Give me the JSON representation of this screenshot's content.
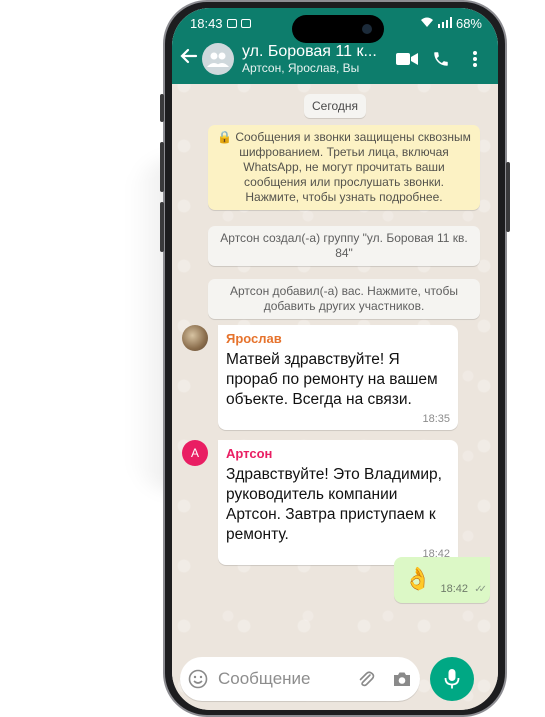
{
  "status_bar": {
    "time": "18:43",
    "battery": "68%"
  },
  "header": {
    "title": "ул. Боровая 11 к...",
    "subtitle": "Артсон, Ярослав, Вы",
    "icons": [
      "back-arrow-icon",
      "group-avatar-icon",
      "video-call-icon",
      "phone-call-icon",
      "more-options-icon"
    ]
  },
  "chat": {
    "date_chip": "Сегодня",
    "encryption_notice": "🔒 Сообщения и звонки защищены сквозным шифрованием. Третьи лица, включая WhatsApp, не могут прочитать ваши сообщения или прослушать звонки. Нажмите, чтобы узнать подробнее.",
    "system_created": "Артсон создал(-а) группу \"ул. Боровая 11 кв. 84\"",
    "system_added": "Артсон добавил(-а) вас. Нажмите, чтобы добавить других участников.",
    "messages": [
      {
        "sender": "Ярослав",
        "sender_color": "#e6732d",
        "text": "Матвей здравствуйте! Я прораб по ремонту на вашем объекте. Всегда на связи.",
        "time": "18:35"
      },
      {
        "sender": "Артсон",
        "sender_color": "#e91e63",
        "avatar_letter": "A",
        "text": "Здравствуйте! Это Владимир, руководитель компании Артсон. Завтра приступаем к ремонту.",
        "time": "18:42"
      }
    ],
    "outgoing": {
      "emoji": "👌",
      "time": "18:42",
      "ticks": "✓✓"
    }
  },
  "composer": {
    "placeholder": "Сообщение"
  },
  "colors": {
    "header": "#0d7d6c",
    "accent": "#00a884",
    "outgoing_bubble": "#dcf8c6",
    "encryption_bg": "#fcf2c4"
  }
}
